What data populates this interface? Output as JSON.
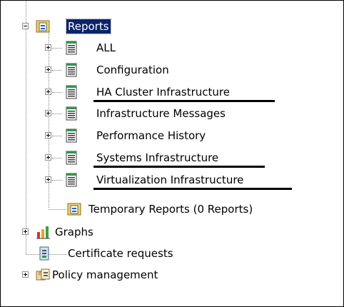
{
  "tree": {
    "reports": {
      "label": "Reports",
      "children": [
        {
          "label": "ALL",
          "underlined": false
        },
        {
          "label": "Configuration",
          "underlined": false
        },
        {
          "label": "HA Cluster Infrastructure",
          "underlined": true
        },
        {
          "label": "Infrastructure Messages",
          "underlined": false
        },
        {
          "label": "Performance History",
          "underlined": false
        },
        {
          "label": "Systems Infrastructure",
          "underlined": true
        },
        {
          "label": "Virtualization Infrastructure",
          "underlined": true
        }
      ],
      "temporary_label": "Temporary Reports (0 Reports)"
    },
    "graphs_label": "Graphs",
    "certificates_label": "Certificate requests",
    "policy_label": "Policy management"
  },
  "colors": {
    "selection": "#0a246a",
    "annotation_underline": "#000000"
  },
  "icons": {
    "reports": "report-folder-icon",
    "report_item": "report-sheet-icon",
    "temporary": "temporary-report-icon",
    "graphs": "graphs-icon",
    "certificates": "certificate-icon",
    "policy": "policy-icon"
  }
}
